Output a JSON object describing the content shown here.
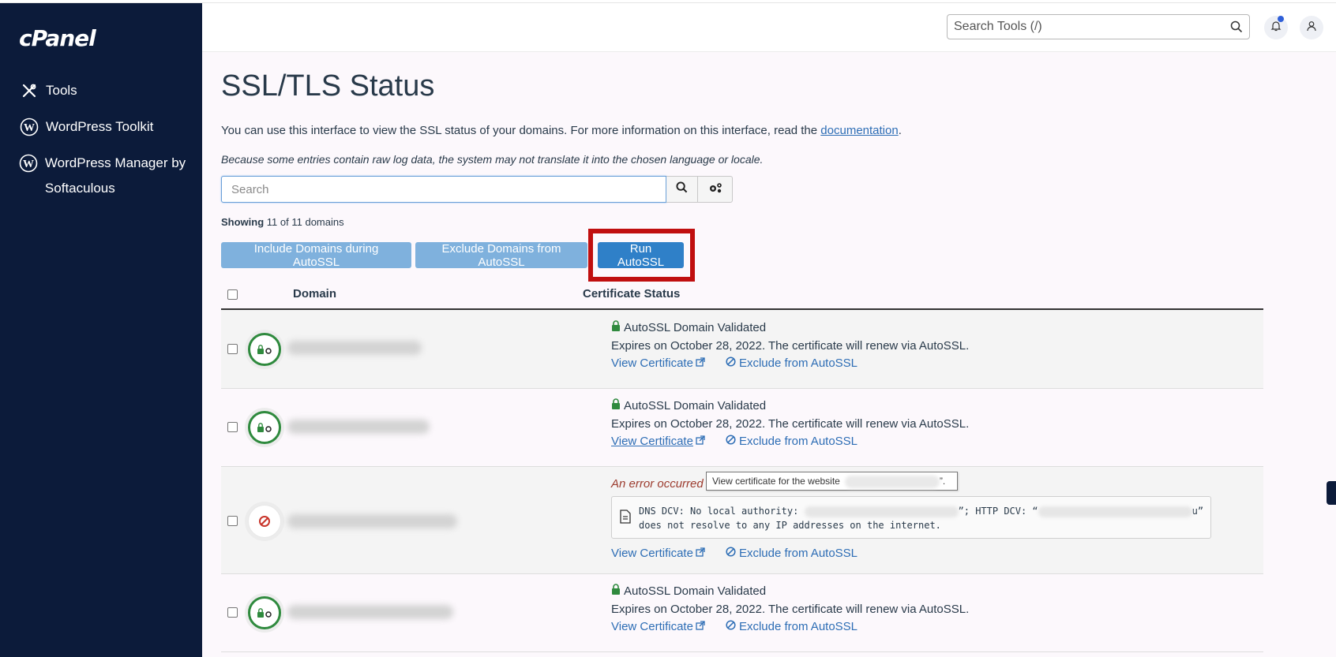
{
  "sidebar": {
    "logo": "cPanel",
    "items": [
      {
        "label": "Tools",
        "icon": "tools-icon"
      },
      {
        "label": "WordPress Toolkit",
        "icon": "wordpress-icon"
      },
      {
        "label": "WordPress Manager by Softaculous",
        "icon": "wordpress-icon"
      }
    ]
  },
  "header": {
    "search_placeholder": "Search Tools (/)",
    "bell_icon": "bell-icon",
    "user_icon": "user-icon"
  },
  "page": {
    "title": "SSL/TLS Status",
    "intro_text": "You can use this interface to view the SSL status of your domains. For more information on this interface, read the ",
    "intro_link": "documentation",
    "intro_end": ".",
    "note": "Because some entries contain raw log data, the system may not translate it into the chosen language or locale.",
    "search_placeholder": "Search",
    "showing_label": "Showing",
    "showing_count": "11 of 11 domains"
  },
  "actions": {
    "include_label": "Include Domains during AutoSSL",
    "exclude_label": "Exclude Domains from AutoSSL",
    "run_label": "Run AutoSSL"
  },
  "table": {
    "col_domain": "Domain",
    "col_status": "Certificate Status",
    "view_cert": "View Certificate",
    "exclude_link": "Exclude from AutoSSL",
    "rows": [
      {
        "status": "AutoSSL Domain Validated",
        "expires": "Expires on October 28, 2022. The certificate will renew via AutoSSL."
      },
      {
        "status": "AutoSSL Domain Validated",
        "expires": "Expires on October 28, 2022. The certificate will renew via AutoSSL."
      },
      {
        "error": "An error occurred t",
        "log_prefix": "DNS DCV: No local authority: ",
        "log_mid": "”; HTTP DCV: “",
        "log_end": "u” does not resolve to any IP addresses on the internet."
      },
      {
        "status": "AutoSSL Domain Validated",
        "expires": "Expires on October 28, 2022. The certificate will renew via AutoSSL."
      }
    ]
  },
  "tooltip": {
    "text": "View certificate for the website",
    "tail": "”."
  },
  "colors": {
    "sidebar_bg": "#0c1b3a",
    "primary_button": "#2f80c8",
    "light_button": "#7fb1dd",
    "highlight_box": "#c00f0f",
    "validated_green": "#2f8a3e",
    "error_red": "#c8342a"
  }
}
